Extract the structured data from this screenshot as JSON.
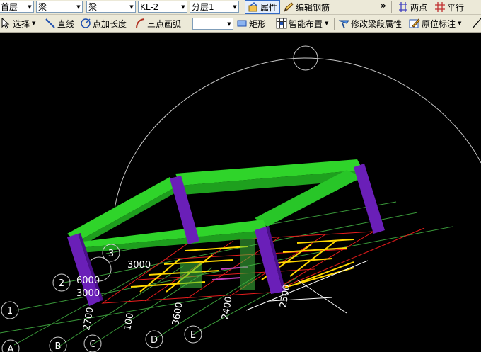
{
  "toolbar1": {
    "floor_select": "首层",
    "component_type_select": "梁",
    "component_subtype_select": "梁",
    "component_name_select": "KL-2",
    "layer_select": "分层1",
    "properties_button": "属性",
    "edit_rebar_button": "编辑钢筋",
    "overflow_chevron": "»",
    "two_points_button": "两点",
    "parallel_button": "平行"
  },
  "toolbar2": {
    "select_button": "选择",
    "line_button": "直线",
    "point_length_button": "点加长度",
    "three_point_arc_button": "三点画弧",
    "rectangle_button": "矩形",
    "smart_layout_button": "智能布置",
    "modify_segment_button": "修改梁段属性",
    "in_situ_annotation_button": "原位标注"
  },
  "viewport": {
    "axis_numbers": [
      "1",
      "2",
      "3"
    ],
    "axis_letters": [
      "A",
      "B",
      "C",
      "D",
      "E"
    ],
    "dimension_labels": [
      "3000",
      "6000",
      "3000",
      "2700",
      "100",
      "3600",
      "2400",
      "2500"
    ],
    "colors": {
      "background": "#000000",
      "beam": "#22c31e",
      "column": "#6a1fb8",
      "slab_rebar": "#ffd800",
      "slab_outline": "#e81c1c",
      "grid": "#40b040",
      "orbit_circle": "#c8c8c8"
    }
  }
}
